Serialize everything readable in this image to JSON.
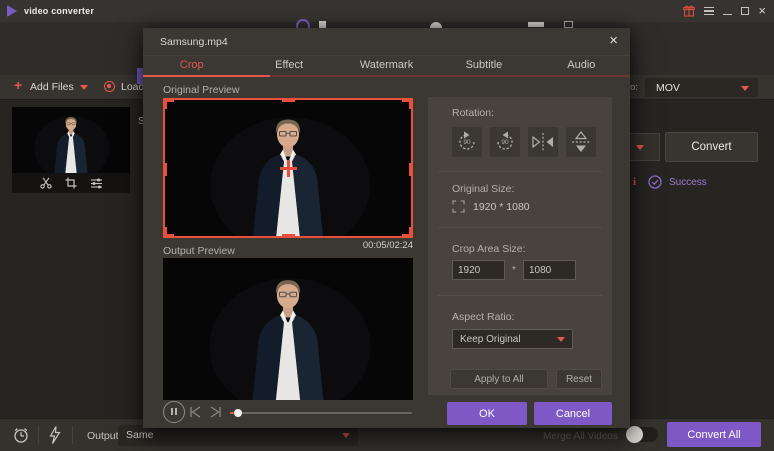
{
  "titlebar": {
    "app_title": "video converter"
  },
  "window_controls": {
    "close_glyph": "×"
  },
  "toolbar": {
    "add_files_label": "Add Files",
    "load_label": "Load",
    "convert_to_label": "s to:",
    "output_format": "MOV"
  },
  "file_row": {
    "filename_visible": "S"
  },
  "file_actions": {
    "convert_label": "Convert",
    "info_glyph": "i",
    "success_label": "Success"
  },
  "dialog": {
    "title": "Samsung.mp4",
    "close_glyph": "×",
    "tabs": [
      "Crop",
      "Effect",
      "Watermark",
      "Subtitle",
      "Audio"
    ],
    "active_tab": "Crop",
    "original_preview_label": "Original Preview",
    "output_preview_label": "Output Preview",
    "time_display": "00:05/02:24",
    "rotation": {
      "label": "Rotation:",
      "angle": "90"
    },
    "original_size": {
      "label": "Original Size:",
      "value": "1920 * 1080"
    },
    "crop_area": {
      "label": "Crop Area Size:",
      "width": "1920",
      "height": "1080",
      "separator": "*"
    },
    "aspect_ratio": {
      "label": "Aspect Ratio:",
      "value": "Keep Original"
    },
    "buttons": {
      "apply_all": "Apply to All",
      "reset": "Reset",
      "ok": "OK",
      "cancel": "Cancel"
    }
  },
  "bottom_bar": {
    "output_label": "Output",
    "output_value": "Same",
    "merge_label": "Merge All Videos",
    "convert_all_label": "Convert All"
  },
  "colors": {
    "accent": "#e4584c",
    "purple": "#7e58c4",
    "success": "#9b7bd0"
  }
}
